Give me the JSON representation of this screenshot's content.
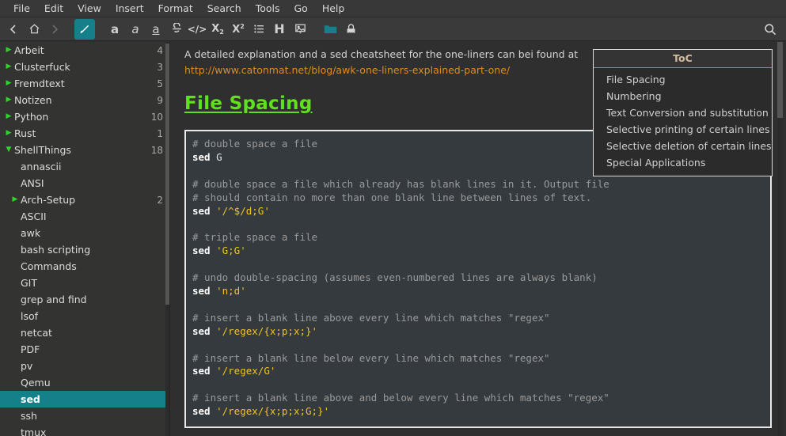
{
  "menu": {
    "items": [
      {
        "label": "File"
      },
      {
        "label": "Edit"
      },
      {
        "label": "View"
      },
      {
        "label": "Insert"
      },
      {
        "label": "Format"
      },
      {
        "label": "Search"
      },
      {
        "label": "Tools"
      },
      {
        "label": "Go"
      },
      {
        "label": "Help"
      }
    ]
  },
  "toolbar": {
    "icons": [
      {
        "name": "back-icon",
        "glyph": "back",
        "state": "enabled"
      },
      {
        "name": "home-icon",
        "glyph": "home",
        "state": "enabled"
      },
      {
        "name": "forward-icon",
        "glyph": "forward",
        "state": "disabled"
      },
      {
        "name": "edit-pencil-icon",
        "glyph": "pencil",
        "state": "active"
      },
      {
        "name": "bold-icon",
        "glyph": "bold-a",
        "state": "enabled"
      },
      {
        "name": "italic-icon",
        "glyph": "italic-a",
        "state": "enabled"
      },
      {
        "name": "underline-icon",
        "glyph": "underline-a",
        "state": "enabled"
      },
      {
        "name": "strikethrough-icon",
        "glyph": "strike",
        "state": "enabled"
      },
      {
        "name": "code-icon",
        "glyph": "code",
        "state": "enabled"
      },
      {
        "name": "subscript-icon",
        "glyph": "subscript",
        "state": "enabled"
      },
      {
        "name": "superscript-icon",
        "glyph": "superscript",
        "state": "enabled"
      },
      {
        "name": "bullet-list-icon",
        "glyph": "list",
        "state": "enabled"
      },
      {
        "name": "heading-icon",
        "glyph": "heading-h",
        "state": "enabled"
      },
      {
        "name": "insert-image-icon",
        "glyph": "image",
        "state": "enabled"
      },
      {
        "name": "folder-icon",
        "glyph": "folder",
        "state": "enabled"
      },
      {
        "name": "lock-icon",
        "glyph": "lock",
        "state": "enabled"
      }
    ],
    "search_icon": "search-icon",
    "accent_color": "#16808a"
  },
  "sidebar": {
    "selected": "sed",
    "selected_color": "#16808a",
    "arrow_color": "#2fd22f",
    "items": [
      {
        "label": "Arbeit",
        "count": "4",
        "level": 0,
        "arrow": "collapsed"
      },
      {
        "label": "Clusterfuck",
        "count": "3",
        "level": 0,
        "arrow": "collapsed"
      },
      {
        "label": "Fremdtext",
        "count": "5",
        "level": 0,
        "arrow": "collapsed"
      },
      {
        "label": "Notizen",
        "count": "9",
        "level": 0,
        "arrow": "collapsed"
      },
      {
        "label": "Python",
        "count": "10",
        "level": 0,
        "arrow": "collapsed"
      },
      {
        "label": "Rust",
        "count": "1",
        "level": 0,
        "arrow": "collapsed"
      },
      {
        "label": "ShellThings",
        "count": "18",
        "level": 0,
        "arrow": "expanded"
      },
      {
        "label": "annascii",
        "count": "",
        "level": 1,
        "arrow": "none"
      },
      {
        "label": "ANSI",
        "count": "",
        "level": 1,
        "arrow": "none"
      },
      {
        "label": "Arch-Setup",
        "count": "2",
        "level": 1,
        "arrow": "collapsed"
      },
      {
        "label": "ASCII",
        "count": "",
        "level": 1,
        "arrow": "none"
      },
      {
        "label": "awk",
        "count": "",
        "level": 1,
        "arrow": "none"
      },
      {
        "label": "bash scripting",
        "count": "",
        "level": 1,
        "arrow": "none"
      },
      {
        "label": "Commands",
        "count": "",
        "level": 1,
        "arrow": "none"
      },
      {
        "label": "GIT",
        "count": "",
        "level": 1,
        "arrow": "none"
      },
      {
        "label": "grep and find",
        "count": "",
        "level": 1,
        "arrow": "none"
      },
      {
        "label": "lsof",
        "count": "",
        "level": 1,
        "arrow": "none"
      },
      {
        "label": "netcat",
        "count": "",
        "level": 1,
        "arrow": "none"
      },
      {
        "label": "PDF",
        "count": "",
        "level": 1,
        "arrow": "none"
      },
      {
        "label": "pv",
        "count": "",
        "level": 1,
        "arrow": "none"
      },
      {
        "label": "Qemu",
        "count": "",
        "level": 1,
        "arrow": "none"
      },
      {
        "label": "sed",
        "count": "",
        "level": 1,
        "arrow": "none",
        "selected": true
      },
      {
        "label": "ssh",
        "count": "",
        "level": 1,
        "arrow": "none"
      },
      {
        "label": "tmux",
        "count": "",
        "level": 1,
        "arrow": "none"
      }
    ]
  },
  "content": {
    "intro_text": "A detailed explanation and a sed cheatsheet for the one-liners can bei found at",
    "intro_url": "http://www.catonmat.net/blog/awk-one-liners-explained-part-one/",
    "url_color": "#e08b1e",
    "heading": "File Spacing",
    "heading_color": "#5fe11d",
    "code_lines": [
      [
        {
          "t": "comment",
          "s": "# double space a file"
        }
      ],
      [
        {
          "t": "cmd",
          "s": "sed"
        },
        {
          "t": "plain",
          "s": " G"
        }
      ],
      [],
      [
        {
          "t": "comment",
          "s": "# double space a file which already has blank lines in it. Output file"
        }
      ],
      [
        {
          "t": "comment",
          "s": "# should contain no more than one blank line between lines of text."
        }
      ],
      [
        {
          "t": "cmd",
          "s": "sed"
        },
        {
          "t": "plain",
          "s": " "
        },
        {
          "t": "str",
          "s": "'/^$/d;G'"
        }
      ],
      [],
      [
        {
          "t": "comment",
          "s": "# triple space a file"
        }
      ],
      [
        {
          "t": "cmd",
          "s": "sed"
        },
        {
          "t": "plain",
          "s": " "
        },
        {
          "t": "str",
          "s": "'G;G'"
        }
      ],
      [],
      [
        {
          "t": "comment",
          "s": "# undo double-spacing (assumes even-numbered lines are always blank)"
        }
      ],
      [
        {
          "t": "cmd",
          "s": "sed"
        },
        {
          "t": "plain",
          "s": " "
        },
        {
          "t": "str",
          "s": "'n;d'"
        }
      ],
      [],
      [
        {
          "t": "comment",
          "s": "# insert a blank line above every line which matches \"regex\""
        }
      ],
      [
        {
          "t": "cmd",
          "s": "sed"
        },
        {
          "t": "plain",
          "s": " "
        },
        {
          "t": "str",
          "s": "'/regex/{x;p;x;}'"
        }
      ],
      [],
      [
        {
          "t": "comment",
          "s": "# insert a blank line below every line which matches \"regex\""
        }
      ],
      [
        {
          "t": "cmd",
          "s": "sed"
        },
        {
          "t": "plain",
          "s": " "
        },
        {
          "t": "str",
          "s": "'/regex/G'"
        }
      ],
      [],
      [
        {
          "t": "comment",
          "s": "# insert a blank line above and below every line which matches \"regex\""
        }
      ],
      [
        {
          "t": "cmd",
          "s": "sed"
        },
        {
          "t": "plain",
          "s": " "
        },
        {
          "t": "str",
          "s": "'/regex/{x;p;x;G;}'"
        }
      ]
    ]
  },
  "toc": {
    "title": "ToC",
    "title_color": "#d6bb9b",
    "items": [
      {
        "label": "File Spacing"
      },
      {
        "label": "Numbering"
      },
      {
        "label": "Text Conversion and substitution"
      },
      {
        "label": "Selective printing of certain lines"
      },
      {
        "label": "Selective deletion of certain lines"
      },
      {
        "label": "Special Applications"
      }
    ]
  }
}
